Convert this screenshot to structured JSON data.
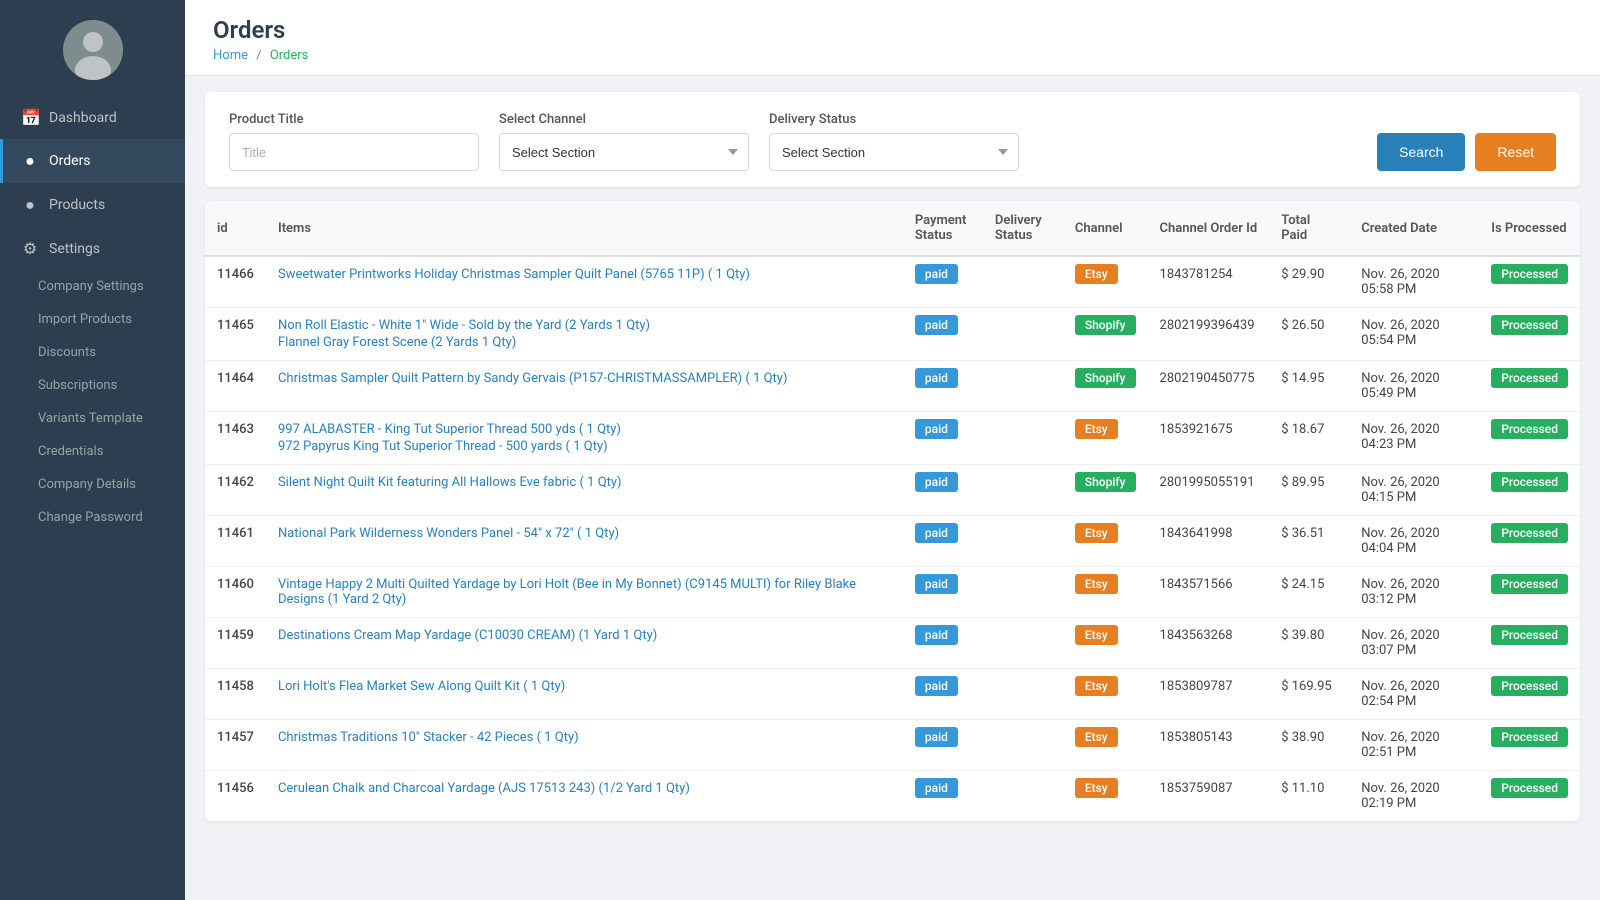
{
  "sidebar": {
    "nav": [
      {
        "id": "dashboard",
        "label": "Dashboard",
        "icon": "📅",
        "active": false
      },
      {
        "id": "orders",
        "label": "Orders",
        "icon": "●",
        "active": true
      },
      {
        "id": "products",
        "label": "Products",
        "icon": "●",
        "active": false
      },
      {
        "id": "settings",
        "label": "Settings",
        "icon": "⚙",
        "active": false
      }
    ],
    "sub_nav": [
      {
        "id": "company-settings",
        "label": "Company Settings"
      },
      {
        "id": "import-products",
        "label": "Import Products"
      },
      {
        "id": "discounts",
        "label": "Discounts"
      },
      {
        "id": "subscriptions",
        "label": "Subscriptions"
      },
      {
        "id": "variants-template",
        "label": "Variants Template"
      },
      {
        "id": "credentials",
        "label": "Credentials"
      },
      {
        "id": "company-details",
        "label": "Company Details"
      },
      {
        "id": "change-password",
        "label": "Change Password"
      }
    ]
  },
  "header": {
    "title": "Orders",
    "breadcrumb_home": "Home",
    "breadcrumb_current": "Orders"
  },
  "filters": {
    "product_title_label": "Product Title",
    "product_title_placeholder": "Title",
    "select_channel_label": "Select Channel",
    "select_channel_placeholder": "Select Section",
    "delivery_status_label": "Delivery Status",
    "delivery_status_placeholder": "Select Section",
    "search_label": "Search",
    "reset_label": "Reset"
  },
  "table": {
    "headers": [
      "id",
      "Items",
      "Payment Status",
      "Delivery Status",
      "Channel",
      "Channel Order Id",
      "Total Paid",
      "Created Date",
      "Is Processed"
    ],
    "rows": [
      {
        "id": "11466",
        "items": [
          "Sweetwater Printworks Holiday Christmas Sampler Quilt Panel (5765 11P) ( 1 Qty)"
        ],
        "payment_status": "paid",
        "delivery_status": "",
        "channel": "Etsy",
        "channel_order_id": "1843781254",
        "total_paid": "$ 29.90",
        "created_date": "Nov. 26, 2020 05:58 PM",
        "is_processed": "Processed"
      },
      {
        "id": "11465",
        "items": [
          "Non Roll Elastic - White 1\" Wide - Sold by the Yard (2 Yards 1 Qty)",
          "Flannel Gray Forest Scene (2 Yards 1 Qty)"
        ],
        "payment_status": "paid",
        "delivery_status": "",
        "channel": "Shopify",
        "channel_order_id": "2802199396439",
        "total_paid": "$ 26.50",
        "created_date": "Nov. 26, 2020 05:54 PM",
        "is_processed": "Processed"
      },
      {
        "id": "11464",
        "items": [
          "Christmas Sampler Quilt Pattern by Sandy Gervais (P157-CHRISTMASSAMPLER) ( 1 Qty)"
        ],
        "payment_status": "paid",
        "delivery_status": "",
        "channel": "Shopify",
        "channel_order_id": "2802190450775",
        "total_paid": "$ 14.95",
        "created_date": "Nov. 26, 2020 05:49 PM",
        "is_processed": "Processed"
      },
      {
        "id": "11463",
        "items": [
          "997 ALABASTER - King Tut Superior Thread 500 yds ( 1 Qty)",
          "972 Papyrus King Tut Superior Thread - 500 yards ( 1 Qty)"
        ],
        "payment_status": "paid",
        "delivery_status": "",
        "channel": "Etsy",
        "channel_order_id": "1853921675",
        "total_paid": "$ 18.67",
        "created_date": "Nov. 26, 2020 04:23 PM",
        "is_processed": "Processed"
      },
      {
        "id": "11462",
        "items": [
          "Silent Night Quilt Kit featuring All Hallows Eve fabric ( 1 Qty)"
        ],
        "payment_status": "paid",
        "delivery_status": "",
        "channel": "Shopify",
        "channel_order_id": "2801995055191",
        "total_paid": "$ 89.95",
        "created_date": "Nov. 26, 2020 04:15 PM",
        "is_processed": "Processed"
      },
      {
        "id": "11461",
        "items": [
          "National Park Wilderness Wonders Panel - 54\" x 72\" ( 1 Qty)"
        ],
        "payment_status": "paid",
        "delivery_status": "",
        "channel": "Etsy",
        "channel_order_id": "1843641998",
        "total_paid": "$ 36.51",
        "created_date": "Nov. 26, 2020 04:04 PM",
        "is_processed": "Processed"
      },
      {
        "id": "11460",
        "items": [
          "Vintage Happy 2 Multi Quilted Yardage by Lori Holt (Bee in My Bonnet) (C9145 MULTI) for Riley Blake Designs (1 Yard 2 Qty)"
        ],
        "payment_status": "paid",
        "delivery_status": "",
        "channel": "Etsy",
        "channel_order_id": "1843571566",
        "total_paid": "$ 24.15",
        "created_date": "Nov. 26, 2020 03:12 PM",
        "is_processed": "Processed"
      },
      {
        "id": "11459",
        "items": [
          "Destinations Cream Map Yardage (C10030 CREAM) (1 Yard 1 Qty)"
        ],
        "payment_status": "paid",
        "delivery_status": "",
        "channel": "Etsy",
        "channel_order_id": "1843563268",
        "total_paid": "$ 39.80",
        "created_date": "Nov. 26, 2020 03:07 PM",
        "is_processed": "Processed"
      },
      {
        "id": "11458",
        "items": [
          "Lori Holt's Flea Market Sew Along Quilt Kit ( 1 Qty)"
        ],
        "payment_status": "paid",
        "delivery_status": "",
        "channel": "Etsy",
        "channel_order_id": "1853809787",
        "total_paid": "$ 169.95",
        "created_date": "Nov. 26, 2020 02:54 PM",
        "is_processed": "Processed"
      },
      {
        "id": "11457",
        "items": [
          "Christmas Traditions 10\" Stacker - 42 Pieces ( 1 Qty)"
        ],
        "payment_status": "paid",
        "delivery_status": "",
        "channel": "Etsy",
        "channel_order_id": "1853805143",
        "total_paid": "$ 38.90",
        "created_date": "Nov. 26, 2020 02:51 PM",
        "is_processed": "Processed"
      },
      {
        "id": "11456",
        "items": [
          "Cerulean Chalk and Charcoal Yardage (AJS 17513 243) (1/2 Yard 1 Qty)"
        ],
        "payment_status": "paid",
        "delivery_status": "",
        "channel": "Etsy",
        "channel_order_id": "1853759087",
        "total_paid": "$ 11.10",
        "created_date": "Nov. 26, 2020 02:19 PM",
        "is_processed": "Processed"
      }
    ]
  }
}
